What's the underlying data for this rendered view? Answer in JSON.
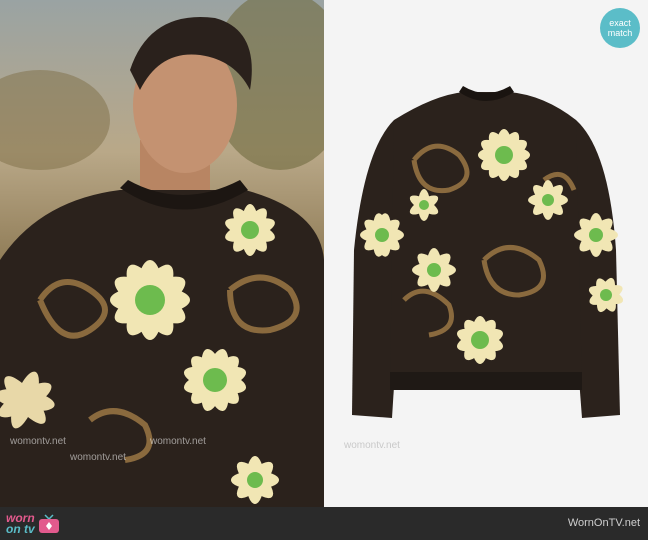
{
  "badge": {
    "line1": "exact",
    "line2": "match"
  },
  "watermarks": [
    "womontv.net",
    "womontv.net",
    "womontv.net",
    "womontv.net"
  ],
  "footer": {
    "logo_worn": "worn",
    "logo_on": "on tv",
    "site": "WornOnTV.net"
  },
  "colors": {
    "accent_pink": "#e25a8d",
    "accent_teal": "#5bbdc8",
    "footer_bg": "#2a2a2a",
    "sweater_base": "#2b221c",
    "flower_petal": "#f1e6b4",
    "flower_center": "#6dbb4e"
  }
}
